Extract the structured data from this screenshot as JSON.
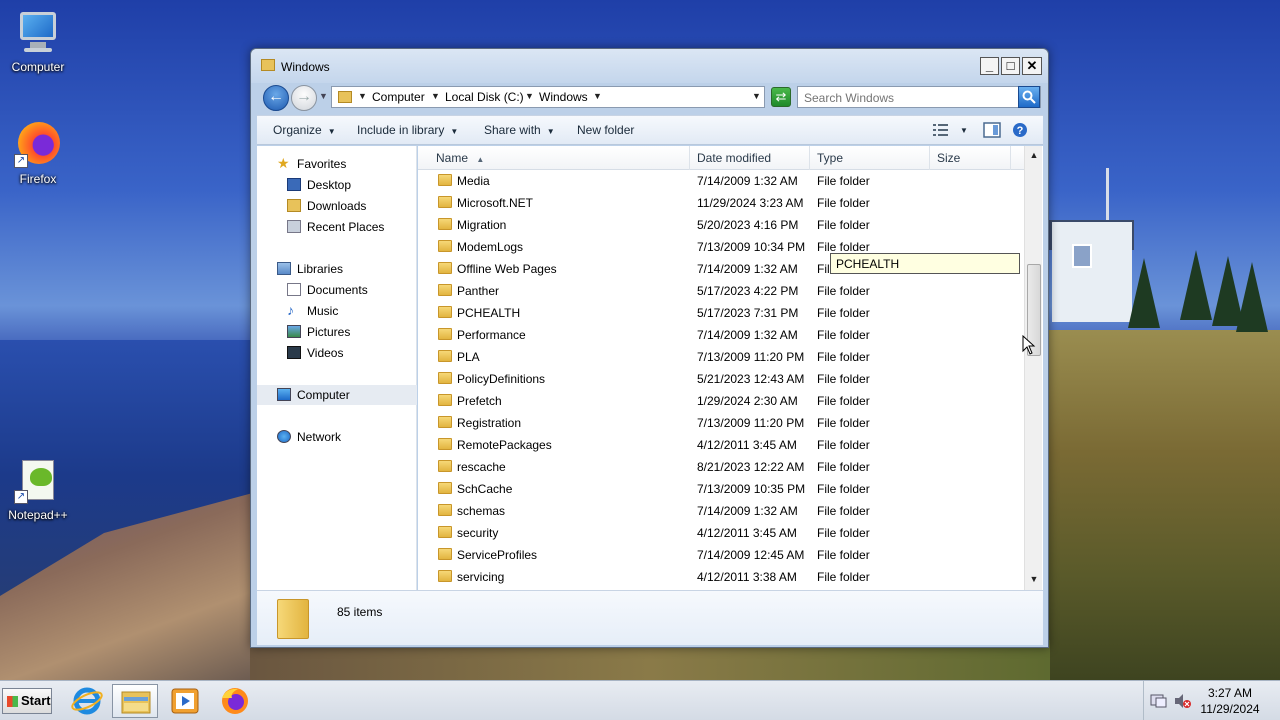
{
  "desktop": {
    "icons": [
      {
        "label": "Computer"
      },
      {
        "label": "Firefox"
      },
      {
        "label": "Notepad++"
      }
    ]
  },
  "window": {
    "title": "Windows",
    "controls": {
      "minimize": "_",
      "maximize": "□",
      "close": "✕"
    }
  },
  "address": {
    "crumbs": [
      "Computer",
      "Local Disk (C:)",
      "Windows"
    ],
    "search_placeholder": "Search Windows"
  },
  "toolbar": {
    "organize": "Organize",
    "include_in_library": "Include in library",
    "share_with": "Share with",
    "new_folder": "New folder"
  },
  "nav": {
    "favorites": "Favorites",
    "desktop": "Desktop",
    "downloads": "Downloads",
    "recent_places": "Recent Places",
    "libraries": "Libraries",
    "documents": "Documents",
    "music": "Music",
    "pictures": "Pictures",
    "videos": "Videos",
    "computer": "Computer",
    "network": "Network"
  },
  "columns": {
    "name": "Name",
    "date_modified": "Date modified",
    "type": "Type",
    "size": "Size"
  },
  "files": [
    {
      "name": "Media",
      "date": "7/14/2009 1:32 AM",
      "type": "File folder"
    },
    {
      "name": "Microsoft.NET",
      "date": "11/29/2024 3:23 AM",
      "type": "File folder"
    },
    {
      "name": "Migration",
      "date": "5/20/2023 4:16 PM",
      "type": "File folder"
    },
    {
      "name": "ModemLogs",
      "date": "7/13/2009 10:34 PM",
      "type": "File folder"
    },
    {
      "name": "Offline Web Pages",
      "date": "7/14/2009 1:32 AM",
      "type": "File folder"
    },
    {
      "name": "Panther",
      "date": "5/17/2023 4:22 PM",
      "type": "File folder"
    },
    {
      "name": "PCHEALTH",
      "date": "5/17/2023 7:31 PM",
      "type": "File folder"
    },
    {
      "name": "Performance",
      "date": "7/14/2009 1:32 AM",
      "type": "File folder"
    },
    {
      "name": "PLA",
      "date": "7/13/2009 11:20 PM",
      "type": "File folder"
    },
    {
      "name": "PolicyDefinitions",
      "date": "5/21/2023 12:43 AM",
      "type": "File folder"
    },
    {
      "name": "Prefetch",
      "date": "1/29/2024 2:30 AM",
      "type": "File folder"
    },
    {
      "name": "Registration",
      "date": "7/13/2009 11:20 PM",
      "type": "File folder"
    },
    {
      "name": "RemotePackages",
      "date": "4/12/2011 3:45 AM",
      "type": "File folder"
    },
    {
      "name": "rescache",
      "date": "8/21/2023 12:22 AM",
      "type": "File folder"
    },
    {
      "name": "SchCache",
      "date": "7/13/2009 10:35 PM",
      "type": "File folder"
    },
    {
      "name": "schemas",
      "date": "7/14/2009 1:32 AM",
      "type": "File folder"
    },
    {
      "name": "security",
      "date": "4/12/2011 3:45 AM",
      "type": "File folder"
    },
    {
      "name": "ServiceProfiles",
      "date": "7/14/2009 12:45 AM",
      "type": "File folder"
    },
    {
      "name": "servicing",
      "date": "4/12/2011 3:38 AM",
      "type": "File folder"
    }
  ],
  "tooltip": "PCHEALTH",
  "details": {
    "count": "85 items"
  },
  "taskbar": {
    "start": "Start",
    "time": "3:27 AM",
    "date": "11/29/2024"
  },
  "colors": {
    "accent": "#1e6ac8",
    "selection": "#e6ebf2",
    "tooltip_bg": "#ffffe1"
  }
}
